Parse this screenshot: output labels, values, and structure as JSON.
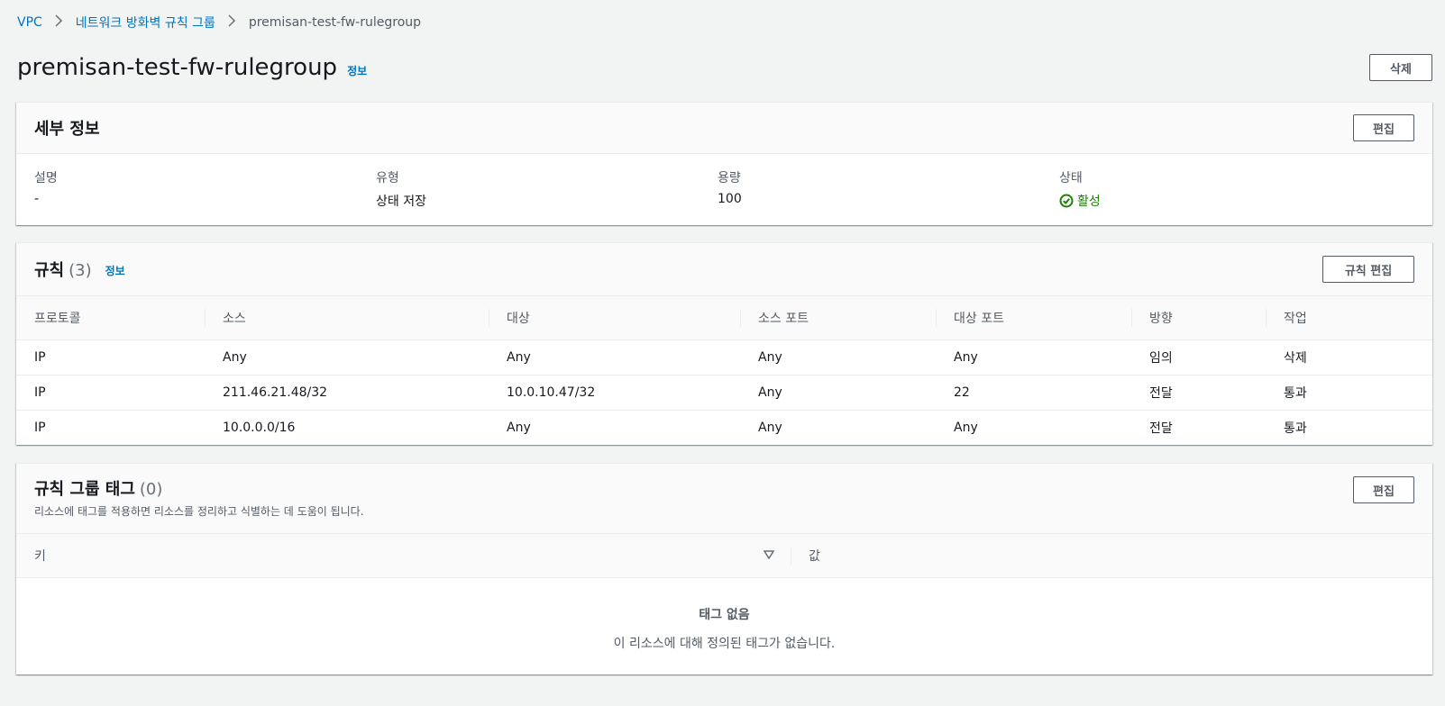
{
  "breadcrumb": {
    "items": [
      "VPC",
      "네트워크 방화벽 규칙 그룹"
    ],
    "current": "premisan-test-fw-rulegroup"
  },
  "header": {
    "title": "premisan-test-fw-rulegroup",
    "info": "정보",
    "delete_label": "삭제"
  },
  "details": {
    "title": "세부 정보",
    "edit_label": "편집",
    "fields": [
      {
        "label": "설명",
        "value": "-"
      },
      {
        "label": "유형",
        "value": "상태 저장"
      },
      {
        "label": "용량",
        "value": "100"
      },
      {
        "label": "상태",
        "value": "활성"
      }
    ],
    "status_color": "#1d8102"
  },
  "rules": {
    "title": "규칙",
    "count": "(3)",
    "info": "정보",
    "edit_label": "규칙 편집",
    "columns": [
      "프로토콜",
      "소스",
      "대상",
      "소스 포트",
      "대상 포트",
      "방향",
      "작업"
    ],
    "rows": [
      [
        "IP",
        "Any",
        "Any",
        "Any",
        "Any",
        "임의",
        "삭제"
      ],
      [
        "IP",
        "211.46.21.48/32",
        "10.0.10.47/32",
        "Any",
        "22",
        "전달",
        "통과"
      ],
      [
        "IP",
        "10.0.0.0/16",
        "Any",
        "Any",
        "Any",
        "전달",
        "통과"
      ]
    ]
  },
  "tags": {
    "title": "규칙 그룹 태그",
    "count": "(0)",
    "description": "리소스에 태그를 적용하면 리소스를 정리하고 식별하는 데 도움이 됩니다.",
    "edit_label": "편집",
    "columns": [
      "키",
      "값"
    ],
    "empty_title": "태그 없음",
    "empty_desc": "이 리소스에 대해 정의된 태그가 없습니다."
  },
  "colors": {
    "link": "#0073bb",
    "background": "#f2f3f3"
  }
}
